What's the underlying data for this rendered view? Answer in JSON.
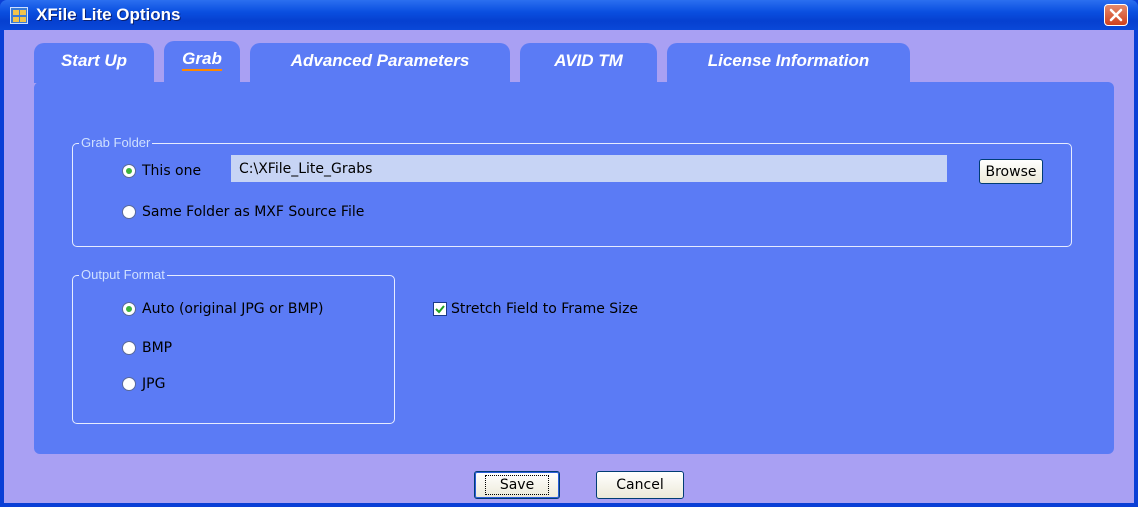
{
  "window": {
    "title": "XFile Lite Options"
  },
  "tabs": [
    {
      "label": "Start Up",
      "active": false
    },
    {
      "label": "Grab",
      "active": true
    },
    {
      "label": "Advanced Parameters",
      "active": false
    },
    {
      "label": "AVID TM",
      "active": false
    },
    {
      "label": "License Information",
      "active": false
    }
  ],
  "grab_folder": {
    "legend": "Grab Folder",
    "option_this_one": "This one",
    "option_this_one_checked": true,
    "path_value": "C:\\XFile_Lite_Grabs",
    "browse_label": "Browse",
    "option_same_folder": "Same Folder as MXF Source File",
    "option_same_folder_checked": false
  },
  "output_format": {
    "legend": "Output Format",
    "options": [
      {
        "label": "Auto (original JPG or BMP)",
        "checked": true
      },
      {
        "label": "BMP",
        "checked": false
      },
      {
        "label": "JPG",
        "checked": false
      }
    ]
  },
  "stretch": {
    "label": "Stretch Field to Frame Size",
    "checked": true
  },
  "footer": {
    "save_label": "Save",
    "cancel_label": "Cancel"
  },
  "colors": {
    "titlebar": "#0a4fe0",
    "client": "#a9a0f3",
    "panel": "#5b7bf5",
    "tab_underline": "#ff8800"
  }
}
